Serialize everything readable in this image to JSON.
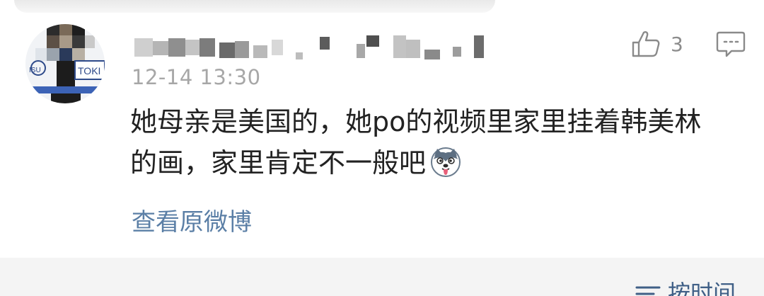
{
  "comment": {
    "timestamp": "12-14 13:30",
    "text_line1": "她母亲是美国的，她po的视频里家里挂着韩美林",
    "text_line2": "的画，家里肯定不一般吧",
    "avatar_caption": "TOKI",
    "like_count": "3",
    "view_origin_label": "查看原微博"
  },
  "icons": {
    "like": "thumbs-up-icon",
    "reply": "comment-bubble-icon",
    "emoji": "husky-dog-emoji-icon",
    "sort": "sort-lines-icon"
  },
  "footer": {
    "sort_label": "按时间"
  },
  "colors": {
    "text": "#222222",
    "meta": "#a7a7a7",
    "link": "#5b7fa6",
    "sort": "#3f5f86"
  }
}
